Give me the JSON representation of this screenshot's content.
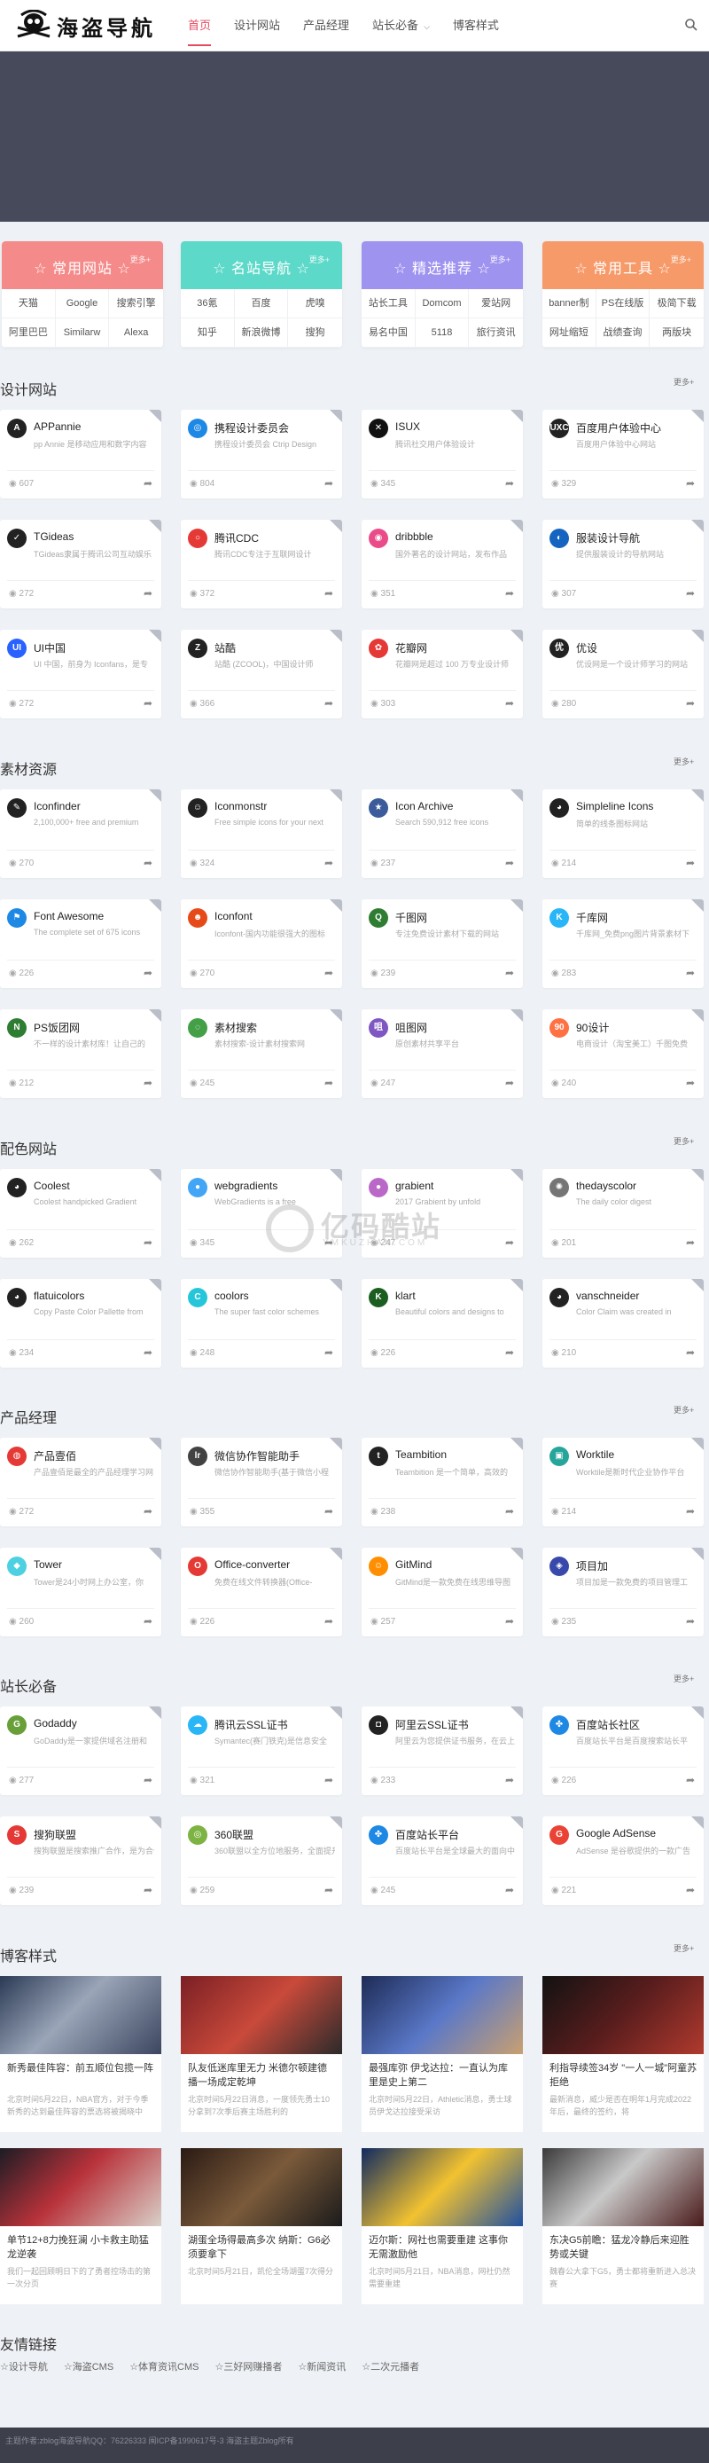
{
  "header": {
    "logo_text": "海盗导航",
    "nav": [
      "首页",
      "设计网站",
      "产品经理",
      "站长必备",
      "博客样式"
    ]
  },
  "colors": {
    "accent": "#e64a5e",
    "pink": "#f58a8a",
    "teal": "#5dd9c9",
    "purple": "#9f93f0",
    "orange": "#f79a6a"
  },
  "categories": [
    {
      "title": "常用网站",
      "more": "更多+",
      "color": "#f58a8a",
      "links": [
        "天猫",
        "Google",
        "搜索引擎",
        "阿里巴巴",
        "Similarw",
        "Alexa"
      ]
    },
    {
      "title": "名站导航",
      "more": "更多+",
      "color": "#5dd9c9",
      "links": [
        "36氪",
        "百度",
        "虎嗅",
        "知乎",
        "新浪微博",
        "搜狗"
      ]
    },
    {
      "title": "精选推荐",
      "more": "更多+",
      "color": "#9f93f0",
      "links": [
        "站长工具",
        "Domcom",
        "爱站网",
        "易名中国",
        "5118",
        "旅行资讯"
      ]
    },
    {
      "title": "常用工具",
      "more": "更多+",
      "color": "#f79a6a",
      "links": [
        "banner制",
        "PS在线版",
        "极简下载",
        "网址缩短",
        "战绩查询",
        "两版块"
      ]
    }
  ],
  "sections": [
    {
      "title": "设计网站",
      "more": "更多+",
      "sites": [
        {
          "name": "APPannie",
          "desc": "pp Annie 是移动应用和数字内容",
          "views": "607",
          "icon": "A",
          "color": "#222"
        },
        {
          "name": "携程设计委员会",
          "desc": "携程设计委员会 Ctrip Design",
          "views": "804",
          "icon": "◎",
          "color": "#1e88e5"
        },
        {
          "name": "ISUX",
          "desc": "腾讯社交用户体验设计",
          "views": "345",
          "icon": "✕",
          "color": "#111"
        },
        {
          "name": "百度用户体验中心",
          "desc": "百度用户体验中心网站",
          "views": "329",
          "icon": "UXC",
          "color": "#222"
        },
        {
          "name": "TGideas",
          "desc": "TGideas隶属于腾讯公司互动娱乐",
          "views": "272",
          "icon": "✓",
          "color": "#222"
        },
        {
          "name": "腾讯CDC",
          "desc": "腾讯CDC专注于互联网设计",
          "views": "372",
          "icon": "○",
          "color": "#e53935"
        },
        {
          "name": "dribbble",
          "desc": "国外著名的设计网站，发布作品",
          "views": "351",
          "icon": "◉",
          "color": "#ea4c89"
        },
        {
          "name": "服装设计导航",
          "desc": "提供服装设计的导航网站",
          "views": "307",
          "icon": "◐",
          "color": "#1565c0"
        },
        {
          "name": "UI中国",
          "desc": "UI 中国，前身为 Iconfans，是专",
          "views": "272",
          "icon": "UI",
          "color": "#2962ff"
        },
        {
          "name": "站酷",
          "desc": "站酷 (ZCOOL)，中国设计师",
          "views": "366",
          "icon": "Z",
          "color": "#222"
        },
        {
          "name": "花瓣网",
          "desc": "花瓣网是超过 100 万专业设计师",
          "views": "303",
          "icon": "✿",
          "color": "#e53935"
        },
        {
          "name": "优设",
          "desc": "优设网是一个设计师学习的网站",
          "views": "280",
          "icon": "优",
          "color": "#222"
        }
      ]
    },
    {
      "title": "素材资源",
      "more": "更多+",
      "sites": [
        {
          "name": "Iconfinder",
          "desc": "2,100,000+ free and premium",
          "views": "270",
          "icon": "✎",
          "color": "#222"
        },
        {
          "name": "Iconmonstr",
          "desc": "Free simple icons for your next",
          "views": "324",
          "icon": "☺",
          "color": "#222"
        },
        {
          "name": "Icon Archive",
          "desc": "Search 590,912 free icons",
          "views": "237",
          "icon": "★",
          "color": "#3b5b9a"
        },
        {
          "name": "Simpleline Icons",
          "desc": "简单的线条图标网站",
          "views": "214",
          "icon": "◕",
          "color": "#222"
        },
        {
          "name": "Font Awesome",
          "desc": "The complete set of 675 icons",
          "views": "226",
          "icon": "⚑",
          "color": "#1e88e5"
        },
        {
          "name": "Iconfont",
          "desc": "Iconfont-国内功能很强大的图标",
          "views": "270",
          "icon": "☻",
          "color": "#e64a19"
        },
        {
          "name": "千图网",
          "desc": "专注免费设计素材下载的网站",
          "views": "239",
          "icon": "Q",
          "color": "#2e7d32"
        },
        {
          "name": "千库网",
          "desc": "千库网_免费png图片背景素材下",
          "views": "283",
          "icon": "K",
          "color": "#29b6f6"
        },
        {
          "name": "PS饭团网",
          "desc": "不一样的设计素材库！让自己的",
          "views": "212",
          "icon": "N",
          "color": "#2e7d32"
        },
        {
          "name": "素材搜索",
          "desc": "素材搜索-设计素材搜索网",
          "views": "245",
          "icon": "◌",
          "color": "#43a047"
        },
        {
          "name": "咀图网",
          "desc": "原创素材共享平台",
          "views": "247",
          "icon": "咀",
          "color": "#7e57c2"
        },
        {
          "name": "90设计",
          "desc": "电商设计（淘宝美工）千图免费",
          "views": "240",
          "icon": "90",
          "color": "#ff7043"
        }
      ]
    },
    {
      "title": "配色网站",
      "more": "更多+",
      "sites": [
        {
          "name": "Coolest",
          "desc": "Coolest handpicked Gradient",
          "views": "262",
          "icon": "◕",
          "color": "#222"
        },
        {
          "name": "webgradients",
          "desc": "WebGradients is a free",
          "views": "345",
          "icon": "●",
          "color": "#42a5f5"
        },
        {
          "name": "grabient",
          "desc": "2017 Grabient by unfold",
          "views": "247",
          "icon": "●",
          "color": "#ba68c8"
        },
        {
          "name": "thedayscolor",
          "desc": "The daily color digest",
          "views": "201",
          "icon": "✺",
          "color": "#757575"
        },
        {
          "name": "flatuicolors",
          "desc": "Copy Paste Color Pallette from",
          "views": "234",
          "icon": "◕",
          "color": "#222"
        },
        {
          "name": "coolors",
          "desc": "The super fast color schemes",
          "views": "248",
          "icon": "C",
          "color": "#26c6da"
        },
        {
          "name": "klart",
          "desc": "Beautiful colors and designs to",
          "views": "226",
          "icon": "K",
          "color": "#1b5e20"
        },
        {
          "name": "vanschneider",
          "desc": "Color Claim was created in",
          "views": "210",
          "icon": "◕",
          "color": "#222"
        }
      ]
    },
    {
      "title": "产品经理",
      "more": "更多+",
      "sites": [
        {
          "name": "产品壹佰",
          "desc": "产品壹佰是最全的产品经理学习网",
          "views": "272",
          "icon": "◍",
          "color": "#e53935"
        },
        {
          "name": "微信协作智能助手",
          "desc": "微信协作智能助手(基于微信小程",
          "views": "355",
          "icon": "lr",
          "color": "#424242"
        },
        {
          "name": "Teambition",
          "desc": "Teambition 是一个简单，高效的",
          "views": "238",
          "icon": "t",
          "color": "#222"
        },
        {
          "name": "Worktile",
          "desc": "Worktile是新时代企业协作平台",
          "views": "214",
          "icon": "▣",
          "color": "#26a69a"
        },
        {
          "name": "Tower",
          "desc": "Tower是24小时网上办公室，你",
          "views": "260",
          "icon": "◆",
          "color": "#4dd0e1"
        },
        {
          "name": "Office-converter",
          "desc": "免费在线文件转换器(Office-",
          "views": "226",
          "icon": "O",
          "color": "#e53935"
        },
        {
          "name": "GitMind",
          "desc": "GitMind是一款免费在线思维导图",
          "views": "257",
          "icon": "☺",
          "color": "#ff8f00"
        },
        {
          "name": "项目加",
          "desc": "项目加是一款免费的项目管理工",
          "views": "235",
          "icon": "◈",
          "color": "#3949ab"
        }
      ]
    },
    {
      "title": "站长必备",
      "more": "更多+",
      "sites": [
        {
          "name": "Godaddy",
          "desc": "GoDaddy是一家提供域名注册和",
          "views": "277",
          "icon": "G",
          "color": "#689f38"
        },
        {
          "name": "腾讯云SSL证书",
          "desc": "Symantec(赛门铁克)是信息安全",
          "views": "321",
          "icon": "☁",
          "color": "#29b6f6"
        },
        {
          "name": "阿里云SSL证书",
          "desc": "阿里云为您提供证书服务，在云上",
          "views": "233",
          "icon": "◘",
          "color": "#222"
        },
        {
          "name": "百度站长社区",
          "desc": "百度站长平台是百度搜索站长平",
          "views": "226",
          "icon": "✤",
          "color": "#1e88e5"
        },
        {
          "name": "搜狗联盟",
          "desc": "搜狗联盟是搜索推广合作，是为合作",
          "views": "239",
          "icon": "S",
          "color": "#e53935"
        },
        {
          "name": "360联盟",
          "desc": "360联盟以全方位地服务，全面提升",
          "views": "259",
          "icon": "◎",
          "color": "#7cb342"
        },
        {
          "name": "百度站长平台",
          "desc": "百度站长平台是全球最大的面向中",
          "views": "245",
          "icon": "✤",
          "color": "#1e88e5"
        },
        {
          "name": "Google AdSense",
          "desc": "AdSense 是谷歌提供的一款广告",
          "views": "221",
          "icon": "G",
          "color": "#ea4335"
        }
      ]
    }
  ],
  "blog": {
    "title": "博客样式",
    "more": "更多+",
    "posts": [
      {
        "title": "新秀最佳阵容：前五顺位包揽一阵",
        "excerpt": "北京时间5月22日，NBA官方，对于今季新秀的达到最佳阵容的票选将被揭晓中"
      },
      {
        "title": "队友低迷库里无力 米德尔顿建德播一场成定乾坤",
        "excerpt": "北京时间5月22日消息，一度领先勇士10分拿到7次季后赛主场胜利的"
      },
      {
        "title": "最强库弥 伊戈达拉：一直认为库里是史上第二",
        "excerpt": "北京时间5月22日，Athletic消息，勇士球员伊戈达拉接受采访"
      },
      {
        "title": "利指导续签34岁 \"一人一城\"阿童苏拒绝",
        "excerpt": "最新消息，威少是否在明年1月完成2022年后，最终的签约，将"
      },
      {
        "title": "单节12+8力挽狂澜 小卡救主助猛龙逆袭",
        "excerpt": "我们一起回顾明日下的了勇者控场击的第一次分页"
      },
      {
        "title": "湖蛋全场得最高多次 纳斯：G6必须要拿下",
        "excerpt": "北京时间5月21日，凯伦全场湖蛋7次得分"
      },
      {
        "title": "迈尔斯：网社也需要重建 这事你无需激励他",
        "excerpt": "北京时间5月21日，NBA消息，网社仍然需要重建"
      },
      {
        "title": "东决G5前瞻：猛龙冷静后来迎胜势或关键",
        "excerpt": "魏春公大拿下G5，勇士都将重新进入总决赛"
      }
    ]
  },
  "friends": {
    "title": "友情链接",
    "links": [
      "☆设计导航",
      "☆海盗CMS",
      "☆体育资讯CMS",
      "☆三好网赚播者",
      "☆新闻资讯",
      "☆二次元播者"
    ]
  },
  "footer": {
    "text": "主题作者:zblog海盗导航QQ：76226333 闽ICP备1990617号-3 海盗主题Zblog所有"
  },
  "watermark": {
    "title": "亿码酷站",
    "sub": "YMKUZHAN.COM"
  }
}
